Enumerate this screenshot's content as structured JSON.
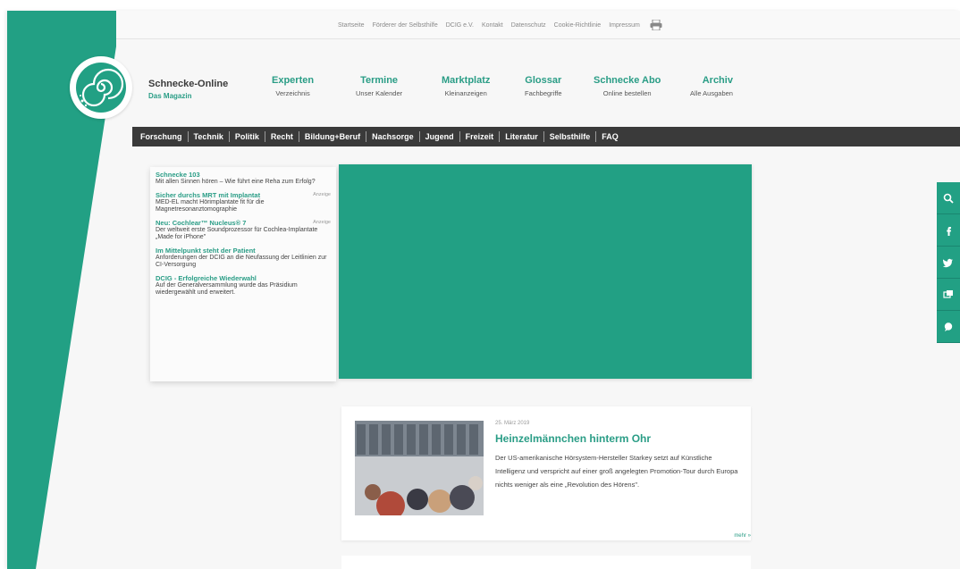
{
  "topbar": {
    "links": [
      "Startseite",
      "Förderer der Selbsthilfe",
      "DCIG e.V.",
      "Kontakt",
      "Datenschutz",
      "Cookie-Richtlinie",
      "Impressum"
    ]
  },
  "brand": {
    "title": "Schnecke-Online",
    "subtitle": "Das Magazin"
  },
  "mainnav": [
    {
      "title": "Experten",
      "sub": "Verzeichnis"
    },
    {
      "title": "Termine",
      "sub": "Unser Kalender"
    },
    {
      "title": "Marktplatz",
      "sub": "Kleinanzeigen"
    },
    {
      "title": "Glossar",
      "sub": "Fachbegriffe"
    },
    {
      "title": "Schnecke Abo",
      "sub": "Online bestellen"
    },
    {
      "title": "Archiv",
      "sub": "Alle Ausgaben"
    }
  ],
  "categories": [
    "Forschung",
    "Technik",
    "Politik",
    "Recht",
    "Bildung+Beruf",
    "Nachsorge",
    "Jugend",
    "Freizeit",
    "Literatur",
    "Selbsthilfe",
    "FAQ"
  ],
  "news": [
    {
      "title": "Schnecke 103",
      "text": "Mit allen Sinnen hören – Wie führt eine Reha zum Erfolg?",
      "ad": ""
    },
    {
      "title": "Sicher durchs MRT mit Implantat",
      "text": "MED-EL macht Hörimplantate fit für die Magnetresonanztomographie",
      "ad": "Anzeige"
    },
    {
      "title": "Neu: Cochlear™ Nucleus® 7",
      "text": "Der weltweit erste Soundprozessor für Cochlea-Implantate „Made for iPhone\"",
      "ad": "Anzeige"
    },
    {
      "title": "Im Mittelpunkt steht der Patient",
      "text": "Anforderungen der DCIG an die Neufassung der Leitlinien zur CI-Versorgung",
      "ad": ""
    },
    {
      "title": "DCIG - Erfolgreiche Wiederwahl",
      "text": "Auf der Generalversammlung wurde das Präsidium wiedergewählt und erweitert.",
      "ad": ""
    }
  ],
  "article": {
    "date": "25. März 2019",
    "title": "Heinzelmännchen hinterm Ohr",
    "text": "Der US-amerikanische Hörsystem-Hersteller Starkey setzt auf Künstliche Intelligenz und verspricht auf einer groß angelegten Promotion-Tour durch Europa nichts weniger als eine „Revolution des Hörens\".",
    "more": "mehr »"
  },
  "colors": {
    "accent": "#2a9d86",
    "slider": "#22a084",
    "catbar": "#3a3a3a"
  },
  "social_icons": [
    "search-icon",
    "facebook-icon",
    "twitter-icon",
    "chat-icon",
    "comment-icon"
  ]
}
